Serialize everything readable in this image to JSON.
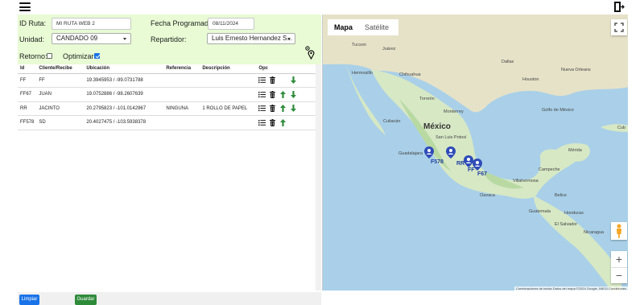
{
  "form": {
    "id_ruta_label": "ID Ruta:",
    "id_ruta_value": "MI RUTA WEB 2",
    "fecha_label": "Fecha Programada:",
    "fecha_value": "08/11/2024",
    "unidad_label": "Unidad:",
    "unidad_value": "CANDADO 09",
    "repartidor_label": "Repartidor:",
    "repartidor_value": "Luis Ernesto Hernandez S...",
    "retorno_label": "Retorno:",
    "retorno_checked": false,
    "optimizar_label": "Optimizar:",
    "optimizar_checked": true
  },
  "table": {
    "columns": [
      "Id",
      "Cliente/Recibe",
      "Ubicación",
      "Referencia",
      "Descripción",
      "Opc"
    ],
    "rows": [
      {
        "id": "FF",
        "cliente": "FF",
        "ubicacion": "19.3945953 / -99.0731788",
        "referencia": "",
        "descripcion": "",
        "up": false,
        "down": true
      },
      {
        "id": "FF67",
        "cliente": "JUAN",
        "ubicacion": "19.0752886 / -98.2607639",
        "referencia": "",
        "descripcion": "",
        "up": true,
        "down": true
      },
      {
        "id": "RR",
        "cliente": "JACINTO",
        "ubicacion": "20.2795823 / -101.0142967",
        "referencia": "NINGUNA",
        "descripcion": "1 ROLLO DE PAPEL",
        "up": true,
        "down": true
      },
      {
        "id": "FF578",
        "cliente": "SD",
        "ubicacion": "20.4027475 / -103.5938378",
        "referencia": "",
        "descripcion": "",
        "up": true,
        "down": false
      }
    ]
  },
  "buttons": {
    "limpiar": "Limpiar",
    "guardar": "Guardar"
  },
  "map": {
    "tab_map": "Mapa",
    "tab_satellite": "Satélite",
    "labels": {
      "tucson": "Tucson",
      "juarez": "Juárez",
      "chihuahua": "Chihuahua",
      "monterrey": "Monterrey",
      "mexico": "México",
      "guadalajara": "Guadalajara",
      "dallas": "Dallas",
      "houston": "Houston",
      "nueva_orleans": "Nueva Orleans",
      "golfo": "Golfo de México",
      "belice": "Belice",
      "guatemala": "Guatemala",
      "honduras": "Honduras",
      "el_salvador": "El Salvador",
      "nicaragua": "Nicaragua",
      "cuba": "Cub",
      "merida": "Mérida",
      "hermosillo": "Hermosillo",
      "torreon": "Torreón",
      "culiacan": "Culiacán",
      "san_luis": "San Luis Potosí",
      "oaxaca": "Oaxaca",
      "villahermosa": "Villahermosa",
      "campeche": "Campeche"
    },
    "marker_labels": [
      "F578",
      "RR",
      "FF",
      "F67"
    ],
    "attribution": "Combinaciones de teclas   Datos del mapa ©2024 Google, INEGI   Condiciones"
  },
  "colors": {
    "form_bg": "#e8fbd4",
    "primary": "#1a73e8",
    "success": "#2e8b3a",
    "marker": "#2e4bb8"
  }
}
